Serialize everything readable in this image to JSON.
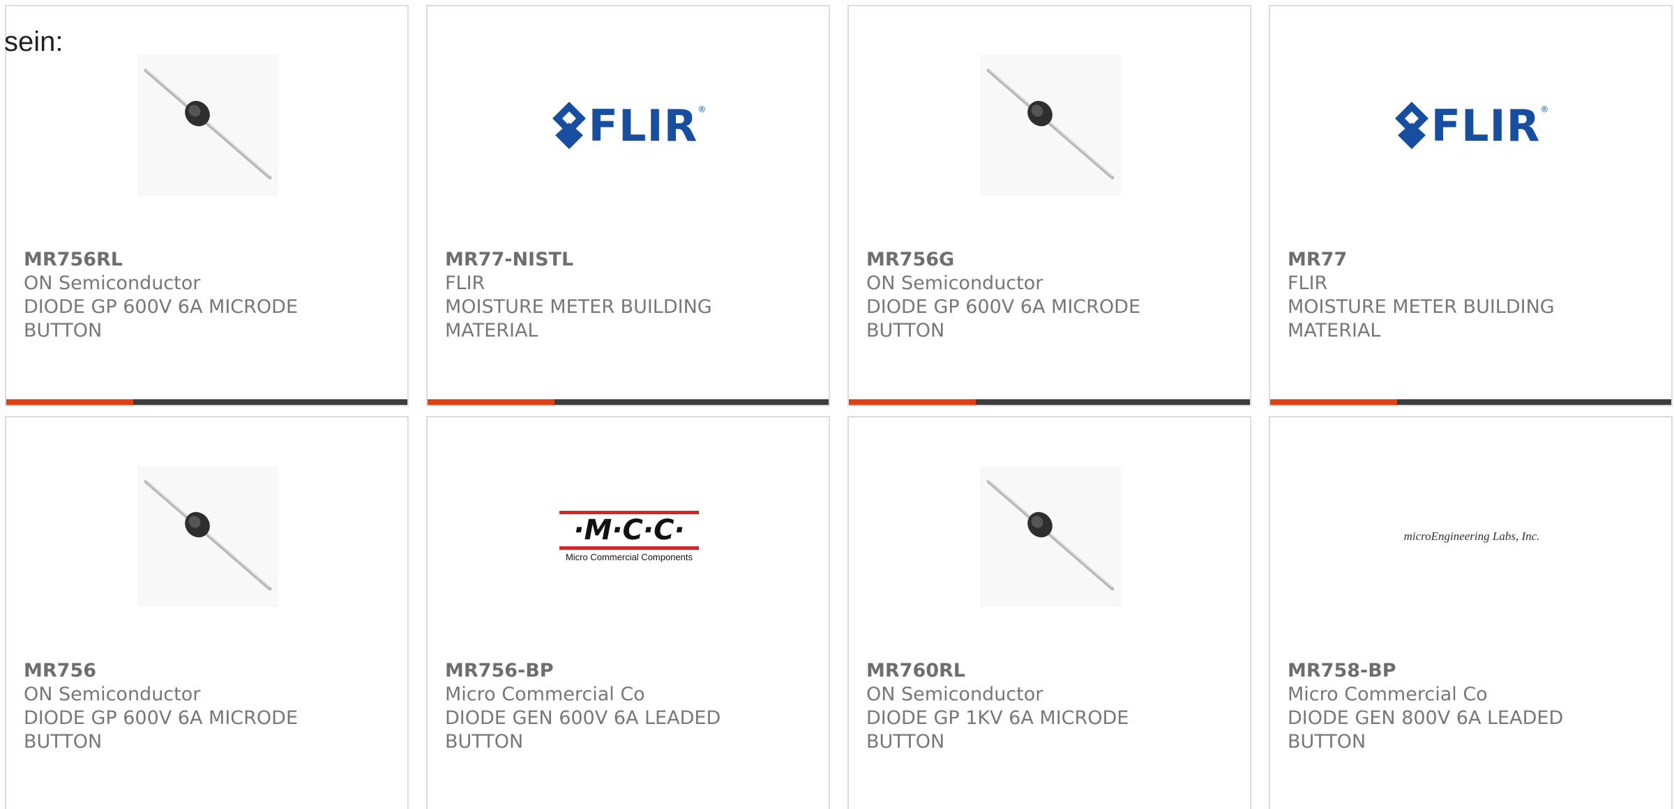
{
  "lead_text": "sein:",
  "products": [
    {
      "part_number": "MR756RL",
      "manufacturer": "ON Semiconductor",
      "description_line1": "DIODE GP 600V 6A MICRODE",
      "description_line2": "BUTTON",
      "image": "axial-diode-image"
    },
    {
      "part_number": "MR77-NISTL",
      "manufacturer": "FLIR",
      "description_line1": "MOISTURE METER BUILDING",
      "description_line2": "MATERIAL",
      "image": "flir-logo",
      "logo_text": "FLIR"
    },
    {
      "part_number": "MR756G",
      "manufacturer": "ON Semiconductor",
      "description_line1": "DIODE GP 600V 6A MICRODE",
      "description_line2": "BUTTON",
      "image": "axial-diode-image"
    },
    {
      "part_number": "MR77",
      "manufacturer": "FLIR",
      "description_line1": "MOISTURE METER BUILDING",
      "description_line2": "MATERIAL",
      "image": "flir-logo",
      "logo_text": "FLIR"
    },
    {
      "part_number": "MR756",
      "manufacturer": "ON Semiconductor",
      "description_line1": "DIODE GP 600V 6A MICRODE",
      "description_line2": "BUTTON",
      "image": "axial-diode-image"
    },
    {
      "part_number": "MR756-BP",
      "manufacturer": "Micro Commercial Co",
      "description_line1": "DIODE GEN 600V 6A LEADED",
      "description_line2": "BUTTON",
      "image": "mcc-logo",
      "logo_text": "·M·C·C·",
      "logo_subtext": "Micro Commercial Components"
    },
    {
      "part_number": "MR760RL",
      "manufacturer": "ON Semiconductor",
      "description_line1": "DIODE GP 1KV 6A MICRODE",
      "description_line2": "BUTTON",
      "image": "axial-diode-image"
    },
    {
      "part_number": "MR758-BP",
      "manufacturer": "Micro Commercial Co",
      "description_line1": "DIODE GEN 800V 6A LEADED",
      "description_line2": "BUTTON",
      "image": "microengineering-labs-logo",
      "logo_text": "microEngineering Labs, Inc."
    }
  ],
  "colors": {
    "accent": "#e0400f",
    "bar": "#3d3d3d",
    "flir_blue": "#174ea0",
    "mcc_red": "#d4262a",
    "text": "#777777"
  }
}
